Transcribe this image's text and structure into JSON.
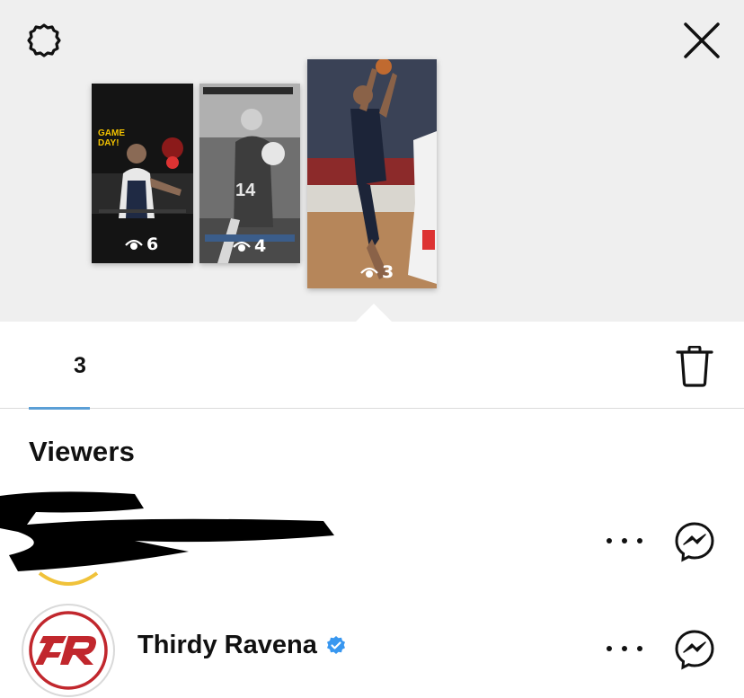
{
  "thumbnails": [
    {
      "headline": "GAME DAY!",
      "views": "6"
    },
    {
      "views": "4",
      "jersey": "14"
    },
    {
      "views": "3"
    }
  ],
  "stats": {
    "views": "3"
  },
  "viewers_heading": "Viewers",
  "viewers": [
    {
      "name": "",
      "redacted": true
    },
    {
      "name": "Thirdy Ravena",
      "verified": true
    }
  ],
  "icons": [
    "gear-icon",
    "close-icon",
    "eye-icon",
    "trash-icon",
    "more-icon",
    "messenger-icon",
    "verified-badge-icon"
  ],
  "colors": {
    "accent_underline": "#5b9fd6",
    "verified_blue": "#3897f0",
    "logo_red": "#c1272d"
  }
}
